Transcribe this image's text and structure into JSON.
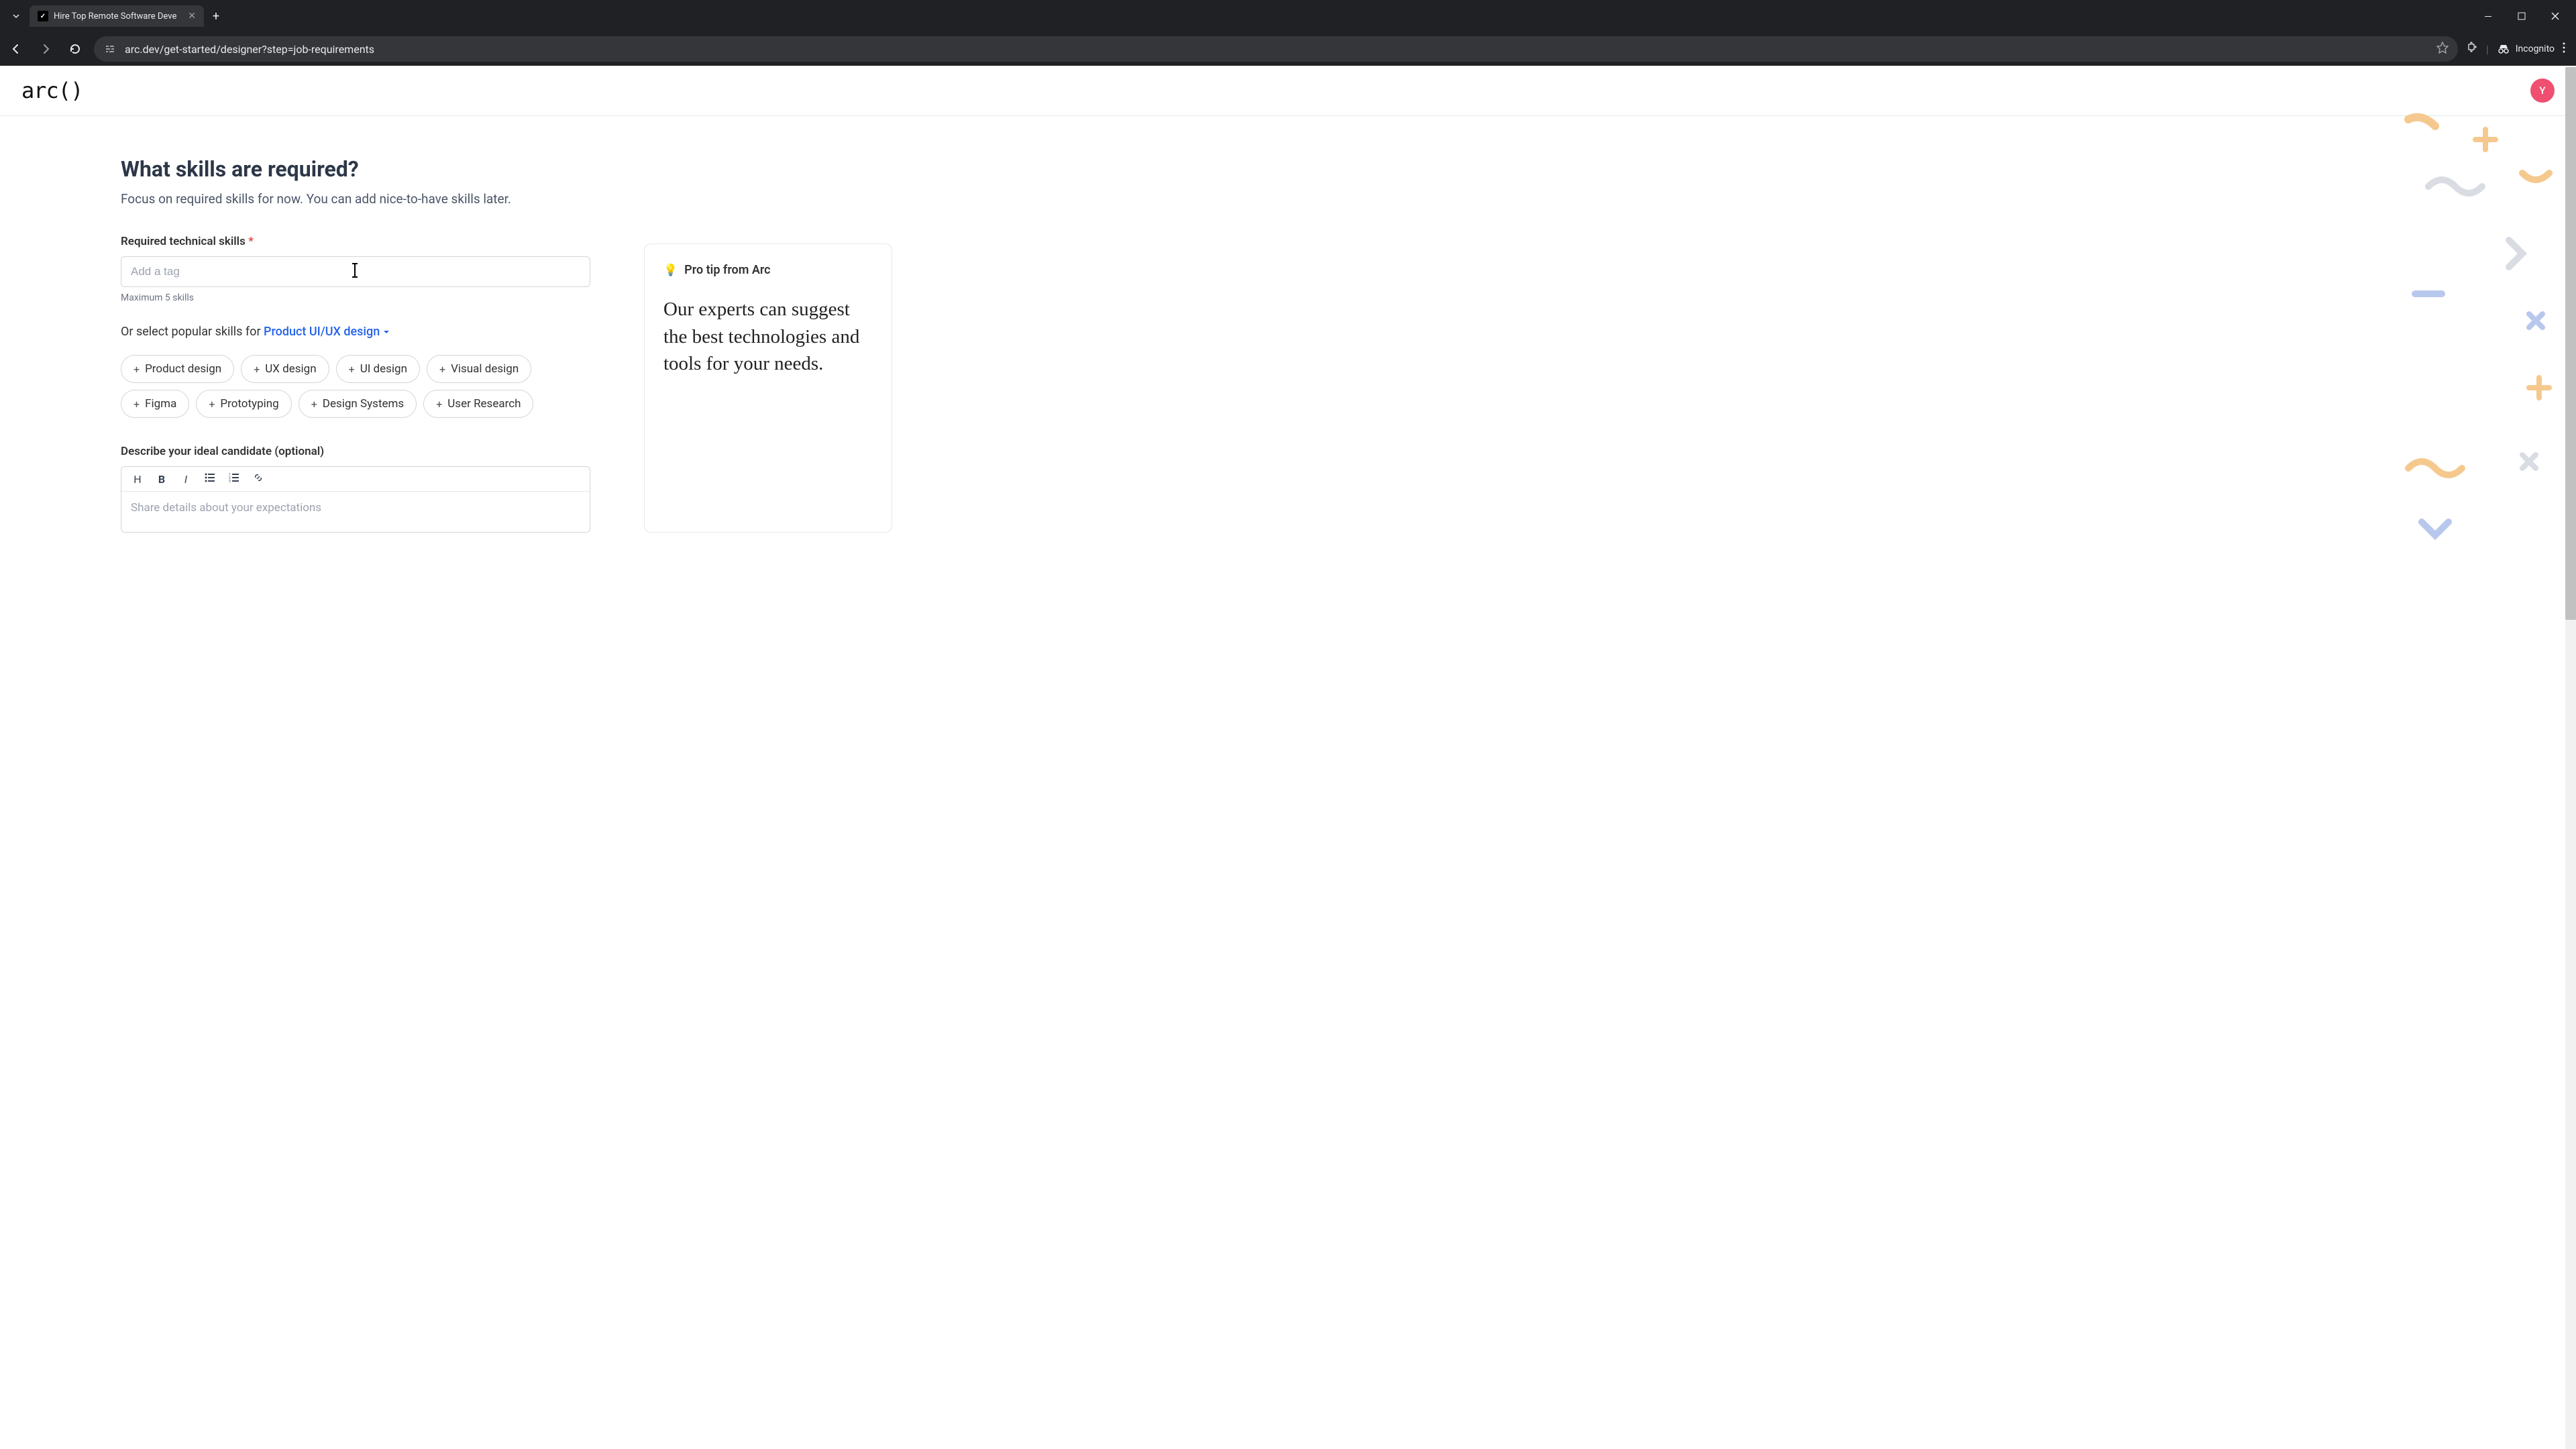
{
  "browser": {
    "tab_title": "Hire Top Remote Software Deve",
    "url": "arc.dev/get-started/designer?step=job-requirements",
    "incognito_label": "Incognito"
  },
  "header": {
    "logo_text": "arc()",
    "avatar_initial": "Y"
  },
  "form": {
    "title": "What skills are required?",
    "subtitle": "Focus on required skills for now. You can add nice-to-have skills later.",
    "skills_label": "Required technical skills",
    "skills_placeholder": "Add a tag",
    "skills_hint": "Maximum 5 skills",
    "popular_prompt_prefix": "Or select popular skills for ",
    "popular_dropdown_label": "Product UI/UX design",
    "chips": [
      "Product design",
      "UX design",
      "UI design",
      "Visual design",
      "Figma",
      "Prototyping",
      "Design Systems",
      "User Research"
    ],
    "describe_label": "Describe your ideal candidate (optional)",
    "describe_placeholder": "Share details about your expectations",
    "editor_buttons": {
      "heading": "H",
      "bold": "B",
      "italic": "I"
    }
  },
  "tip": {
    "header": "Pro tip from Arc",
    "body": "Our experts can suggest the best technologies and tools for your needs."
  }
}
